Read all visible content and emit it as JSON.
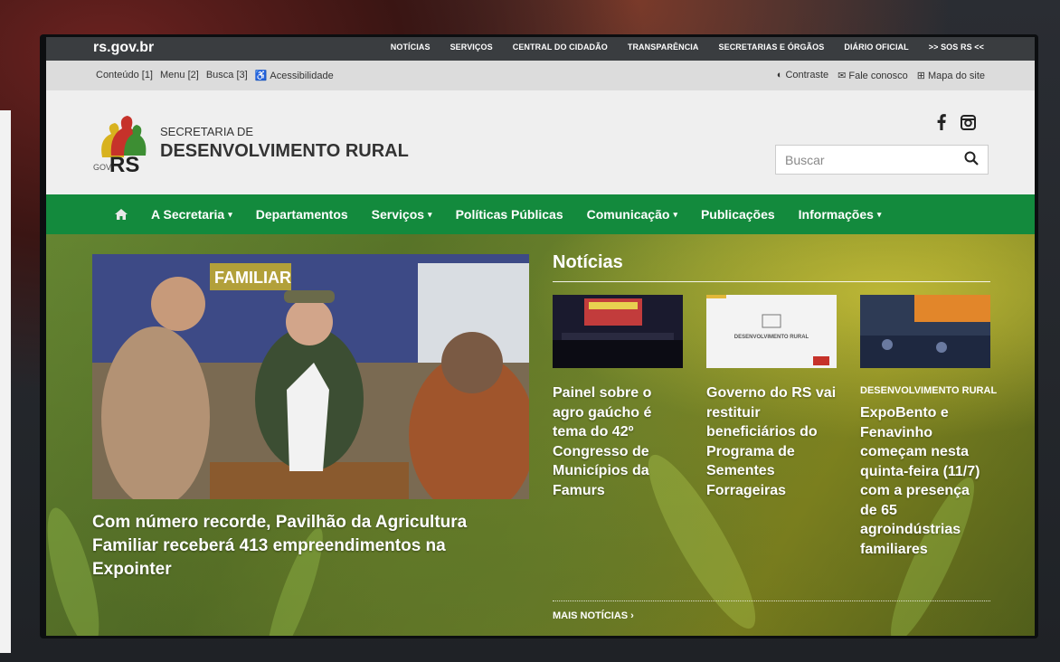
{
  "govbar": {
    "brand": "rs.gov.br",
    "links": [
      "NOTÍCIAS",
      "SERVIÇOS",
      "CENTRAL DO CIDADÃO",
      "TRANSPARÊNCIA",
      "SECRETARIAS E ÓRGÃOS",
      "DIÁRIO OFICIAL",
      ">> SOS RS <<"
    ]
  },
  "accessibility": {
    "left": [
      "Conteúdo [1]",
      "Menu [2]",
      "Busca [3]",
      "Acessibilidade"
    ],
    "contrast": "Contraste",
    "contact": "Fale conosco",
    "sitemap": "Mapa do site"
  },
  "header": {
    "logo_gov": "GOV",
    "logo_rs": "RS",
    "sec_small": "SECRETARIA DE",
    "sec_big": "DESENVOLVIMENTO RURAL",
    "search_placeholder": "Buscar",
    "social": [
      "facebook-icon",
      "instagram-icon"
    ]
  },
  "nav": {
    "items": [
      {
        "label": "A Secretaria",
        "dropdown": true
      },
      {
        "label": "Departamentos",
        "dropdown": false
      },
      {
        "label": "Serviços",
        "dropdown": true
      },
      {
        "label": "Políticas Públicas",
        "dropdown": false
      },
      {
        "label": "Comunicação",
        "dropdown": true
      },
      {
        "label": "Publicações",
        "dropdown": false
      },
      {
        "label": "Informações",
        "dropdown": true
      }
    ],
    "home_icon": "home-icon"
  },
  "featured": {
    "headline": "Com número recorde, Pavilhão da Agricultura Familiar receberá 413 empreendimentos na Expointer",
    "image_sign": "FAMILIAR"
  },
  "news": {
    "title": "Notícias",
    "items": [
      {
        "tag": "",
        "title": "Painel sobre o agro gaúcho é tema do 42º Congresso de Municípios da Famurs"
      },
      {
        "tag": "",
        "title": "Governo do RS vai restituir beneficiários do Programa de Sementes Forrageiras",
        "thumb_text": "DESENVOLVIMENTO RURAL"
      },
      {
        "tag": "DESENVOLVIMENTO RURAL",
        "title": "ExpoBento e Fenavinho começam nesta quinta-feira (11/7) com a presença de 65 agroindústrias familiares"
      }
    ],
    "more": "MAIS NOTÍCIAS ›"
  },
  "colors": {
    "green": "#138a3d",
    "govbar": "#3a3d40"
  }
}
